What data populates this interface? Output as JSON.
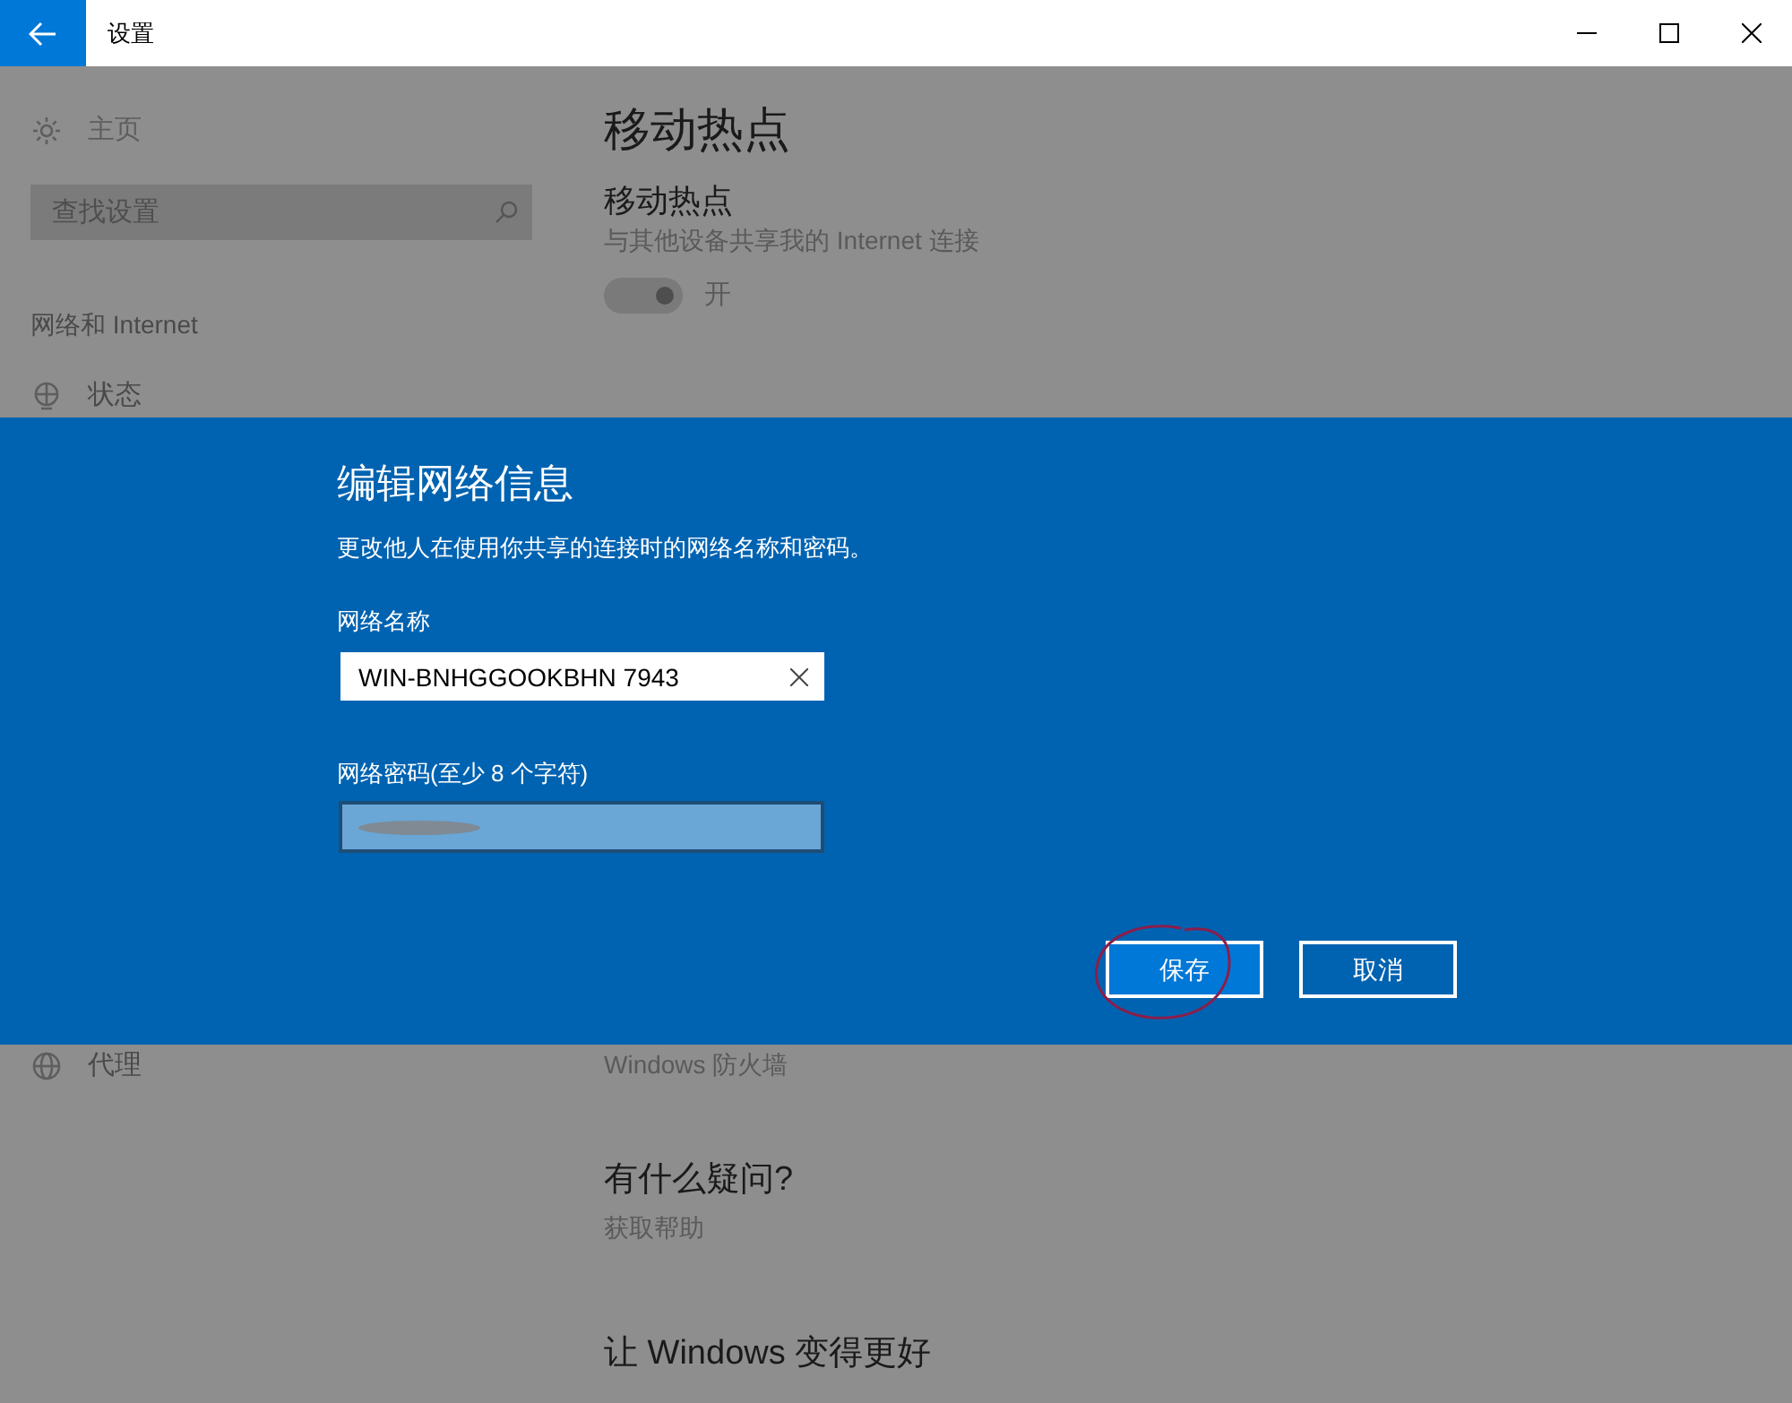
{
  "window": {
    "title": "设置"
  },
  "sidebar": {
    "home": "主页",
    "search": {
      "placeholder": "查找设置"
    },
    "section": "网络和 Internet",
    "items": [
      {
        "label": "状态",
        "kind": "status"
      },
      {
        "label": "代理",
        "kind": "globe"
      }
    ]
  },
  "content": {
    "title": "移动热点",
    "hotspot": {
      "heading": "移动热点",
      "description": "与其他设备共享我的 Internet 连接",
      "toggle": {
        "on": true,
        "label": "开"
      }
    },
    "firewall_link": "Windows 防火墙",
    "help": {
      "heading": "有什么疑问?",
      "link": "获取帮助"
    },
    "feedback": {
      "heading": "让 Windows 变得更好"
    }
  },
  "dialog": {
    "title": "编辑网络信息",
    "description": "更改他人在使用你共享的连接时的网络名称和密码。",
    "name_field": {
      "label": "网络名称",
      "value": "WIN-BNHGGOOKBHN 7943"
    },
    "password_field": {
      "label": "网络密码(至少 8 个字符)"
    },
    "buttons": [
      {
        "label": "保存",
        "primary": true
      },
      {
        "label": "取消",
        "primary": false
      }
    ]
  }
}
